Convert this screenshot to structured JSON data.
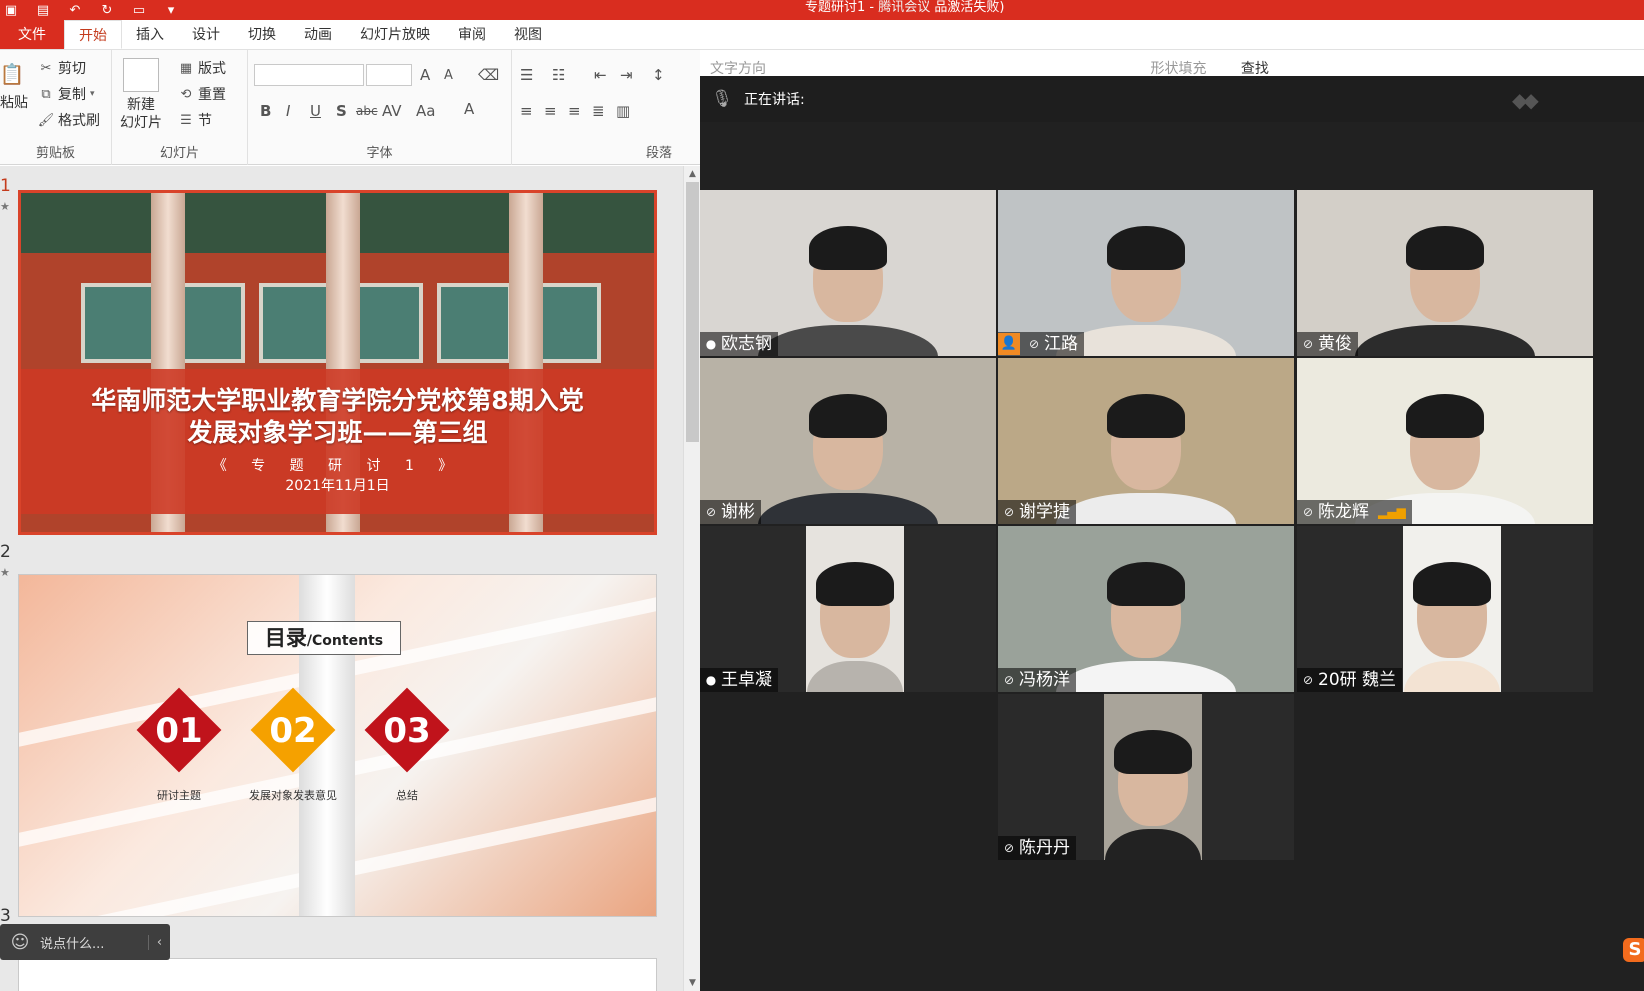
{
  "window": {
    "title_prefix": "专题研讨1 -",
    "title_suffix": "腾讯会议",
    "title_status": "品激活失败)"
  },
  "ribbon": {
    "tabs": [
      "文件",
      "开始",
      "插入",
      "设计",
      "切换",
      "动画",
      "幻灯片放映",
      "审阅",
      "视图"
    ],
    "active_tab": "开始",
    "clipboard": {
      "paste": "粘贴",
      "cut": "剪切",
      "copy": "复制",
      "format_painter": "格式刷",
      "group_label": "剪贴板"
    },
    "slides": {
      "new_slide_line1": "新建",
      "new_slide_line2": "幻灯片",
      "layout": "版式",
      "reset": "重置",
      "section": "节",
      "group_label": "幻灯片"
    },
    "font": {
      "bold": "B",
      "italic": "I",
      "underline": "U",
      "shadow": "S",
      "strike": "abc",
      "spacing": "AV",
      "case": "Aa",
      "color": "A",
      "grow": "A",
      "shrink": "A",
      "group_label": "字体"
    },
    "paragraph": {
      "group_label": "段落",
      "text_direction": "文字方向"
    },
    "drawing": {
      "shape_fill": "形状填充"
    },
    "editing": {
      "find": "查找"
    }
  },
  "slides": [
    {
      "number": "1",
      "title_line1": "华南师范大学职业教育学院分党校第8期入党",
      "title_line2": "发展对象学习班——第三组",
      "subtitle": "《 专 题 研 讨 1 》",
      "date": "2021年11月1日"
    },
    {
      "number": "2",
      "heading_big": "目录",
      "heading_small": "/Contents",
      "items": [
        {
          "num": "01",
          "label": "研讨主题",
          "color": "#c0131b"
        },
        {
          "num": "02",
          "label": "发展对象发表意见",
          "color": "#f5a100"
        },
        {
          "num": "03",
          "label": "总结",
          "color": "#c0131b"
        }
      ]
    },
    {
      "number": "3"
    }
  ],
  "chat": {
    "placeholder": "说点什么..."
  },
  "meeting": {
    "speaking_label": "正在讲话:",
    "participants": [
      {
        "name": "欧志钢",
        "mic": "on",
        "host": false,
        "signal": false,
        "bg": "#d9d6d2",
        "shirt": "#4a4a4a",
        "narrow": false
      },
      {
        "name": "江路",
        "mic": "muted",
        "host": true,
        "signal": false,
        "bg": "#bfc3c5",
        "shirt": "#e8e2da",
        "narrow": false
      },
      {
        "name": "黄俊",
        "mic": "muted",
        "host": false,
        "signal": false,
        "bg": "#d3cfc8",
        "shirt": "#2c2c2c",
        "narrow": false
      },
      {
        "name": "谢彬",
        "mic": "muted",
        "host": false,
        "signal": false,
        "bg": "#b8b2a6",
        "shirt": "#2f3237",
        "narrow": false
      },
      {
        "name": "谢学捷",
        "mic": "muted",
        "host": false,
        "signal": false,
        "bg": "#bba887",
        "shirt": "#ececec",
        "narrow": false
      },
      {
        "name": "陈龙辉",
        "mic": "muted",
        "host": false,
        "signal": true,
        "bg": "#eceadf",
        "shirt": "#f4f4f2",
        "narrow": false
      },
      {
        "name": "王卓凝",
        "mic": "on",
        "host": false,
        "signal": false,
        "bg": "#e6e3de",
        "shirt": "#b7b3ad",
        "narrow": true
      },
      {
        "name": "冯杨洋",
        "mic": "muted",
        "host": false,
        "signal": false,
        "bg": "#9aa29a",
        "shirt": "#f4f4f4",
        "narrow": false
      },
      {
        "name": "20研 魏兰",
        "mic": "muted",
        "host": false,
        "signal": false,
        "bg": "#f1f0ec",
        "shirt": "#f3e3d3",
        "narrow": true
      },
      {
        "name": "陈丹丹",
        "mic": "muted",
        "host": false,
        "signal": false,
        "bg": "#a9a49a",
        "shirt": "#222222",
        "narrow": true
      }
    ]
  }
}
